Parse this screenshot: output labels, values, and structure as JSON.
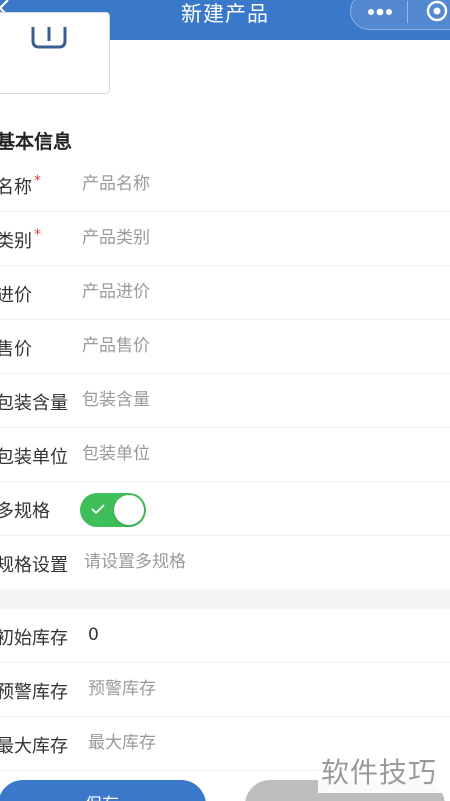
{
  "header": {
    "title": "新建产品"
  },
  "form": {
    "section_title": "基本信息",
    "rows": [
      {
        "label": "名称",
        "required": "*",
        "placeholder": "产品名称"
      },
      {
        "label": "类别",
        "required": "*",
        "placeholder": "产品类别"
      },
      {
        "label": "进价",
        "placeholder": "产品进价"
      },
      {
        "label": "售价",
        "placeholder": "产品售价"
      },
      {
        "label": "包装含量",
        "placeholder": "包装含量"
      },
      {
        "label": "包装单位",
        "placeholder": "包装单位"
      },
      {
        "label": "多规格",
        "toggle_on": true
      },
      {
        "label": "规格设置",
        "placeholder": "请设置多规格"
      }
    ],
    "stock_rows": [
      {
        "label": "初始库存",
        "value": "0"
      },
      {
        "label": "预警库存",
        "placeholder": "预警库存"
      },
      {
        "label": "最大库存",
        "placeholder": "最大库存"
      }
    ]
  },
  "footer": {
    "save_label": "保存"
  },
  "watermark": "软件技巧",
  "colors": {
    "primary": "#3a78c9",
    "toggle_on": "#3fbf5a",
    "required": "#e0453d"
  }
}
